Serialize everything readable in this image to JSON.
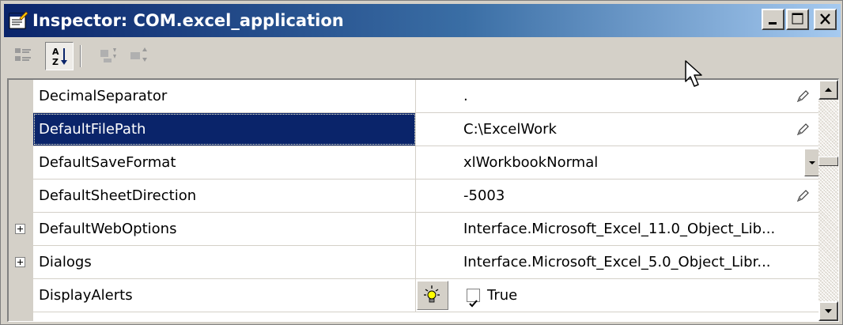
{
  "window": {
    "title": "Inspector: COM.excel_application",
    "title_icon": "inspector-icon",
    "controls": [
      "minimize-icon",
      "maximize-icon",
      "close-icon"
    ]
  },
  "toolbar": {
    "buttons": [
      {
        "name": "categorized-view",
        "icon": "categorized-icon",
        "pressed": false
      },
      {
        "name": "alphabetical-sort",
        "icon": "sort-az-icon",
        "pressed": true
      },
      {
        "name": "expand-all",
        "icon": "expand-all-icon",
        "pressed": false
      },
      {
        "name": "collapse-all",
        "icon": "collapse-all-icon",
        "pressed": false
      }
    ]
  },
  "properties": [
    {
      "name": "DecimalSeparator",
      "value": ".",
      "editor": "pencil",
      "expandable": false,
      "selected": false
    },
    {
      "name": "DefaultFilePath",
      "value": "C:\\ExcelWork",
      "editor": "pencil",
      "expandable": false,
      "selected": true
    },
    {
      "name": "DefaultSaveFormat",
      "value": "xlWorkbookNormal",
      "editor": "dropdown",
      "expandable": false,
      "selected": false
    },
    {
      "name": "DefaultSheetDirection",
      "value": "-5003",
      "editor": "pencil",
      "expandable": false,
      "selected": false
    },
    {
      "name": "DefaultWebOptions",
      "value": "Interface.Microsoft_Excel_11.0_Object_Lib...",
      "editor": "none",
      "expandable": true,
      "selected": false
    },
    {
      "name": "Dialogs",
      "value": "Interface.Microsoft_Excel_5.0_Object_Libr...",
      "editor": "none",
      "expandable": true,
      "selected": false
    },
    {
      "name": "DisplayAlerts",
      "value": "True",
      "editor": "checkbox",
      "checked": true,
      "expandable": false,
      "selected": false
    }
  ],
  "colors": {
    "titlebar_start": "#0a246a",
    "titlebar_end": "#a6caf0",
    "selection": "#0a246a",
    "face": "#d4d0c8"
  }
}
